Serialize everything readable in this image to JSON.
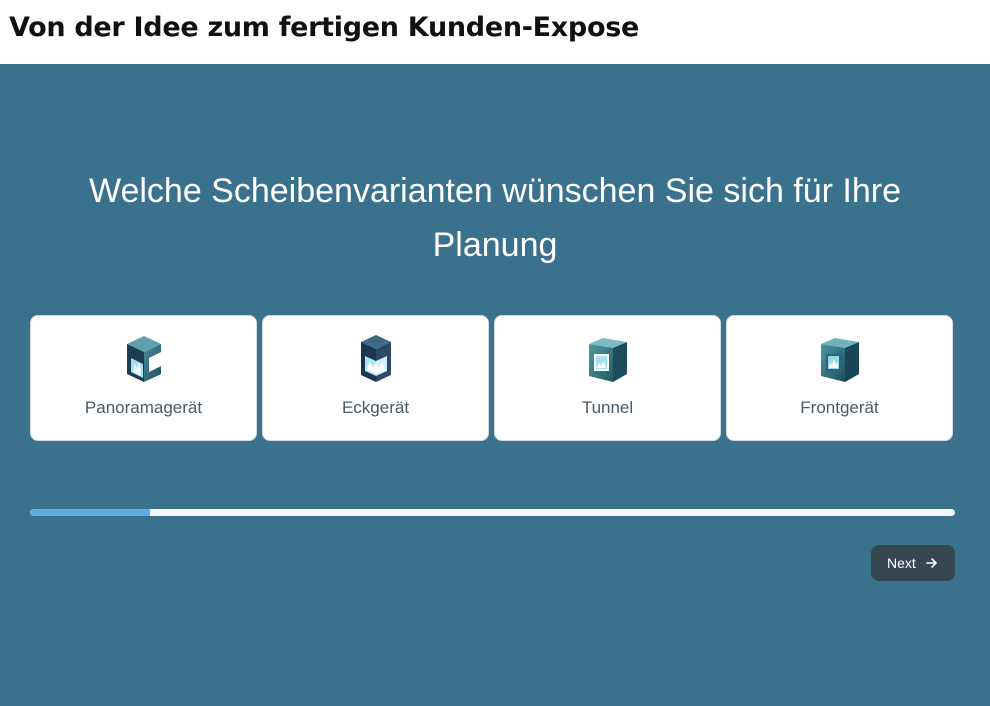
{
  "header": {
    "title": "Von der Idee zum fertigen Kunden-Expose"
  },
  "main": {
    "question": "Welche Scheibenvarianten wünschen Sie sich für Ihre Planung",
    "options": [
      {
        "label": "Panoramagerät",
        "icon": "panorama-fireplace-icon"
      },
      {
        "label": "Eckgerät",
        "icon": "corner-fireplace-icon"
      },
      {
        "label": "Tunnel",
        "icon": "tunnel-fireplace-icon"
      },
      {
        "label": "Frontgerät",
        "icon": "front-fireplace-icon"
      }
    ],
    "progress": 0.13,
    "next_label": "Next",
    "next_icon": "arrow-right-icon"
  },
  "colors": {
    "panel_bg": "#3a718d",
    "progress_fill": "#5aaee3",
    "button_bg": "#37474f"
  }
}
